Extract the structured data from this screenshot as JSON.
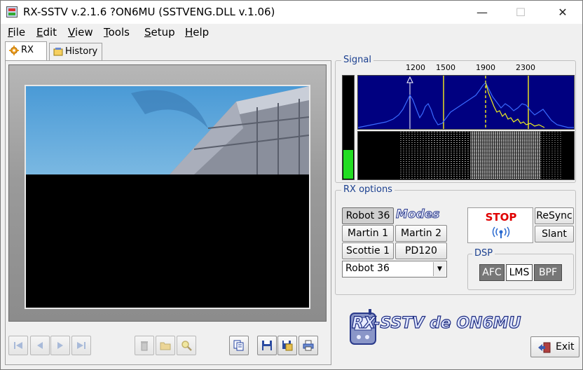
{
  "window": {
    "title": "RX-SSTV v.2.1.6 ?ON6MU (SSTVENG.DLL v.1.06)",
    "minimize": "—",
    "maximize": "☐",
    "close": "✕"
  },
  "menu": [
    "File",
    "Edit",
    "View",
    "Tools",
    "Setup",
    "Help"
  ],
  "tabs": [
    {
      "label": "RX",
      "icon": "gear-icon"
    },
    {
      "label": "History",
      "icon": "history-icon"
    }
  ],
  "signal": {
    "label": "Signal",
    "freq_ticks": [
      "1200",
      "1500",
      "1900",
      "2300"
    ],
    "meter_level": 0.28
  },
  "rx_options": {
    "label": "RX options",
    "modes": [
      "Robot 36",
      "Martin 1",
      "Martin 2",
      "Scottie 1",
      "PD120"
    ],
    "modes_logo": "Modes",
    "selected_mode": "Robot 36",
    "stop_label": "STOP",
    "resync_label": "ReSync",
    "slant_label": "Slant",
    "dsp": {
      "label": "DSP",
      "buttons": [
        "AFC",
        "LMS",
        "BPF"
      ]
    }
  },
  "brand": "RX-SSTV de ON6MU",
  "exit_label": "Exit",
  "colors": {
    "stop": "#e00000",
    "group_label": "#1a3f8f",
    "meter": "#22dd22",
    "spectrum_bg": "#000080"
  }
}
